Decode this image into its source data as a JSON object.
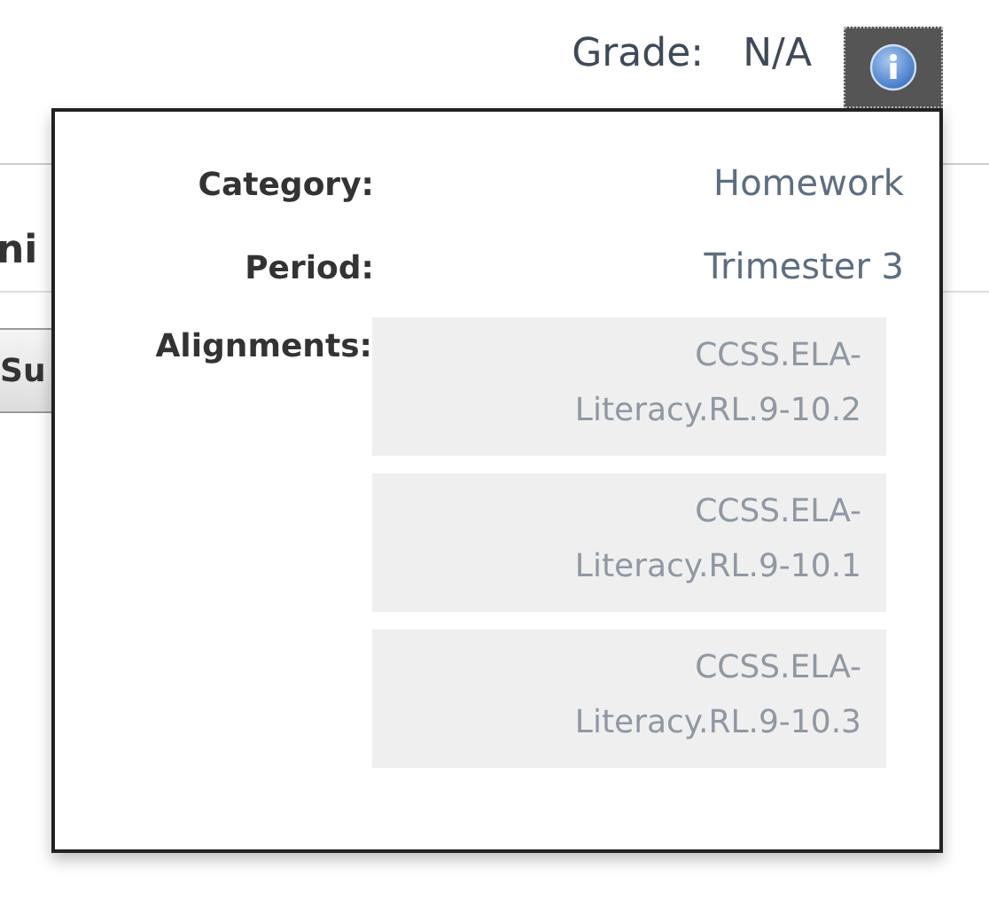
{
  "grade": {
    "label": "Grade:",
    "value": "N/A"
  },
  "background": {
    "heading": "ni",
    "button": "Su"
  },
  "popup": {
    "rows": [
      {
        "label": "Category:",
        "value": "Homework"
      },
      {
        "label": "Period:",
        "value": "Trimester 3"
      }
    ],
    "alignments_label": "Alignments:",
    "alignments": [
      "CCSS.ELA-Literacy.RL.9-10.2",
      "CCSS.ELA-Literacy.RL.9-10.1",
      "CCSS.ELA-Literacy.RL.9-10.3"
    ]
  }
}
